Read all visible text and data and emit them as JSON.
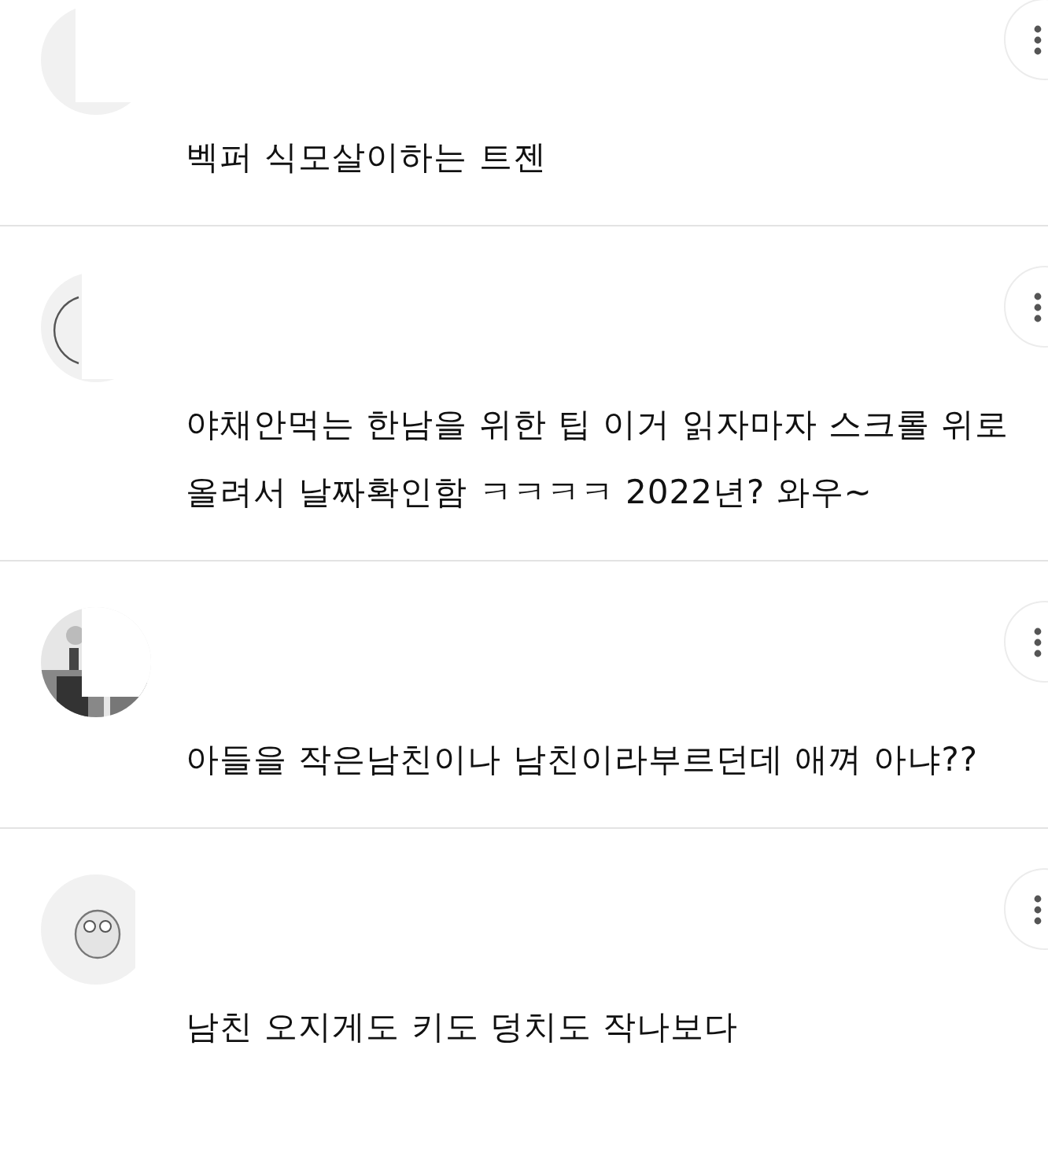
{
  "comments": [
    {
      "avatar": {
        "kind": "blank"
      },
      "text": "벡퍼 식모살이하는 트젠"
    },
    {
      "avatar": {
        "kind": "outline"
      },
      "text": "야채안먹는 한남을 위한 팁 이거 읽자마자 스크롤 위로 올려서 날짜확인함 ㅋㅋㅋㅋ 2022년? 와우~"
    },
    {
      "text": "아들을 작은남친이나 남친이라부르던데 애껴 아냐??"
    },
    {
      "avatar": {
        "kind": "mascot"
      },
      "text": "남친 오지게도 키도 덩치도 작나보다"
    }
  ]
}
